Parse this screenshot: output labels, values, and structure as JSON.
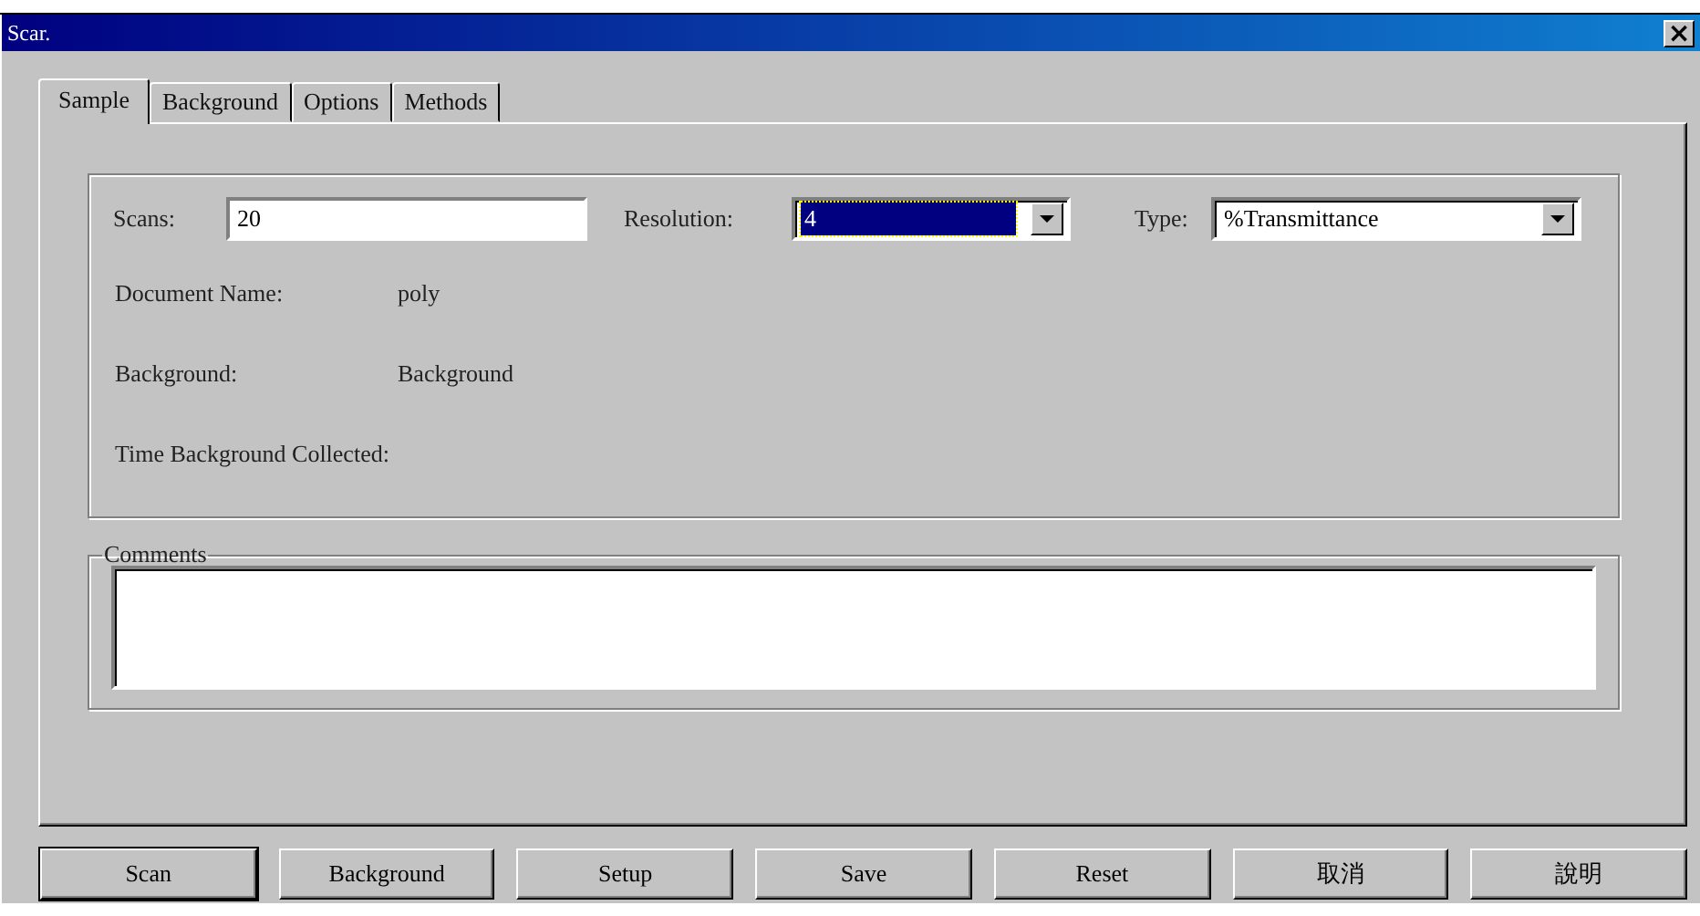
{
  "window": {
    "title": "Scar.",
    "close": "×"
  },
  "tabs": [
    {
      "label": "Sample",
      "selected": true
    },
    {
      "label": "Background",
      "selected": false
    },
    {
      "label": "Options",
      "selected": false
    },
    {
      "label": "Methods",
      "selected": false
    }
  ],
  "settings": [
    {
      "kind": "text",
      "label": "Scans:",
      "value": "20"
    },
    {
      "kind": "combo",
      "label": "Resolution:",
      "value": "4",
      "highlighted": true
    },
    {
      "kind": "combo",
      "label": "Type:",
      "value": "%Transmittance",
      "highlighted": false
    }
  ],
  "info": [
    {
      "label": "Document Name:",
      "value": "poly"
    },
    {
      "label": "Background:",
      "value": "Background"
    },
    {
      "label": "Time Background Collected:"
    }
  ],
  "comments": {
    "label": "Comments"
  },
  "buttons": [
    "Scan",
    "Background",
    "Setup",
    "Save",
    "Reset",
    "取消",
    "說明"
  ]
}
